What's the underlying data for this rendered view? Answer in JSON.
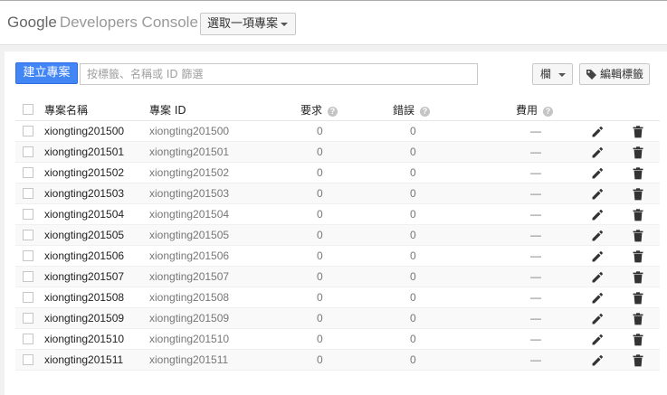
{
  "header": {
    "logo_google": "Google",
    "logo_product": "Developers Console",
    "project_select_label": "選取一項專案"
  },
  "toolbar": {
    "create_label": "建立專案",
    "filter_placeholder": "按標籤、名稱或 ID 篩選",
    "columns_label": "欄",
    "edit_tags_label": "編輯標籤"
  },
  "table": {
    "headers": {
      "name": "專案名稱",
      "id": "專案 ID",
      "requests": "要求",
      "errors": "錯誤",
      "billing": "費用"
    },
    "rows": [
      {
        "name": "xiongting201500",
        "id": "xiongting201500",
        "requests": "0",
        "errors": "0",
        "billing": "—"
      },
      {
        "name": "xiongting201501",
        "id": "xiongting201501",
        "requests": "0",
        "errors": "0",
        "billing": "—"
      },
      {
        "name": "xiongting201502",
        "id": "xiongting201502",
        "requests": "0",
        "errors": "0",
        "billing": "—"
      },
      {
        "name": "xiongting201503",
        "id": "xiongting201503",
        "requests": "0",
        "errors": "0",
        "billing": "—"
      },
      {
        "name": "xiongting201504",
        "id": "xiongting201504",
        "requests": "0",
        "errors": "0",
        "billing": "—"
      },
      {
        "name": "xiongting201505",
        "id": "xiongting201505",
        "requests": "0",
        "errors": "0",
        "billing": "—"
      },
      {
        "name": "xiongting201506",
        "id": "xiongting201506",
        "requests": "0",
        "errors": "0",
        "billing": "—"
      },
      {
        "name": "xiongting201507",
        "id": "xiongting201507",
        "requests": "0",
        "errors": "0",
        "billing": "—"
      },
      {
        "name": "xiongting201508",
        "id": "xiongting201508",
        "requests": "0",
        "errors": "0",
        "billing": "—"
      },
      {
        "name": "xiongting201509",
        "id": "xiongting201509",
        "requests": "0",
        "errors": "0",
        "billing": "—"
      },
      {
        "name": "xiongting201510",
        "id": "xiongting201510",
        "requests": "0",
        "errors": "0",
        "billing": "—"
      },
      {
        "name": "xiongting201511",
        "id": "xiongting201511",
        "requests": "0",
        "errors": "0",
        "billing": "—"
      }
    ]
  },
  "icons": {
    "help": "help-circle-icon",
    "edit": "pencil-icon",
    "delete": "trash-icon",
    "tag": "tag-icon",
    "dropdown": "caret-down-icon"
  },
  "colors": {
    "primary_button": "#4285f4",
    "header_bg": "#ffffff",
    "page_bg": "#f1f1f1"
  }
}
